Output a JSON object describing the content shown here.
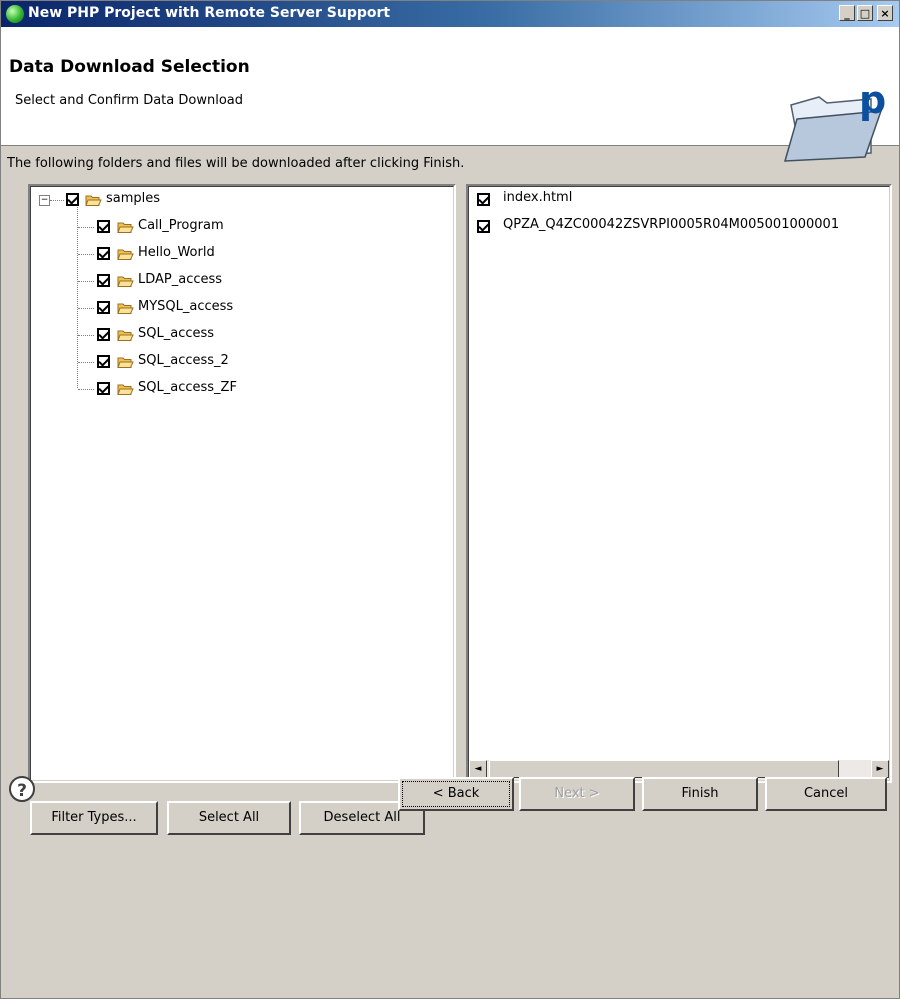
{
  "window": {
    "title": "New PHP Project with Remote Server Support",
    "minimize": "_",
    "maximize": "□",
    "close": "×"
  },
  "header": {
    "title": "Data Download Selection",
    "subtitle": "Select and Confirm Data Download",
    "logo_letter": "p"
  },
  "info_text": "The following folders and files will be downloaded after clicking Finish.",
  "tree": {
    "expander": "−",
    "root": {
      "label": "samples",
      "checked": true
    },
    "children": [
      {
        "label": "Call_Program",
        "checked": true
      },
      {
        "label": "Hello_World",
        "checked": true
      },
      {
        "label": "LDAP_access",
        "checked": true
      },
      {
        "label": "MYSQL_access",
        "checked": true
      },
      {
        "label": "SQL_access",
        "checked": true
      },
      {
        "label": "SQL_access_2",
        "checked": true
      },
      {
        "label": "SQL_access_ZF",
        "checked": true
      }
    ]
  },
  "files": [
    {
      "label": "index.html",
      "checked": true
    },
    {
      "label": "QPZA_Q4ZC00042ZSVRPI0005R04M005001000001",
      "checked": true
    }
  ],
  "scrollbar": {
    "left": "◄",
    "right": "►"
  },
  "buttons": {
    "filter_types": "Filter Types...",
    "select_all": "Select All",
    "deselect_all": "Deselect All",
    "back": "< Back",
    "next": "Next >",
    "finish": "Finish",
    "cancel": "Cancel",
    "help": "?"
  },
  "colors": {
    "titlebar_start": "#0a246a",
    "titlebar_end": "#a6caf0",
    "window_bg": "#d4d0c8",
    "folder": "#f0c050"
  }
}
